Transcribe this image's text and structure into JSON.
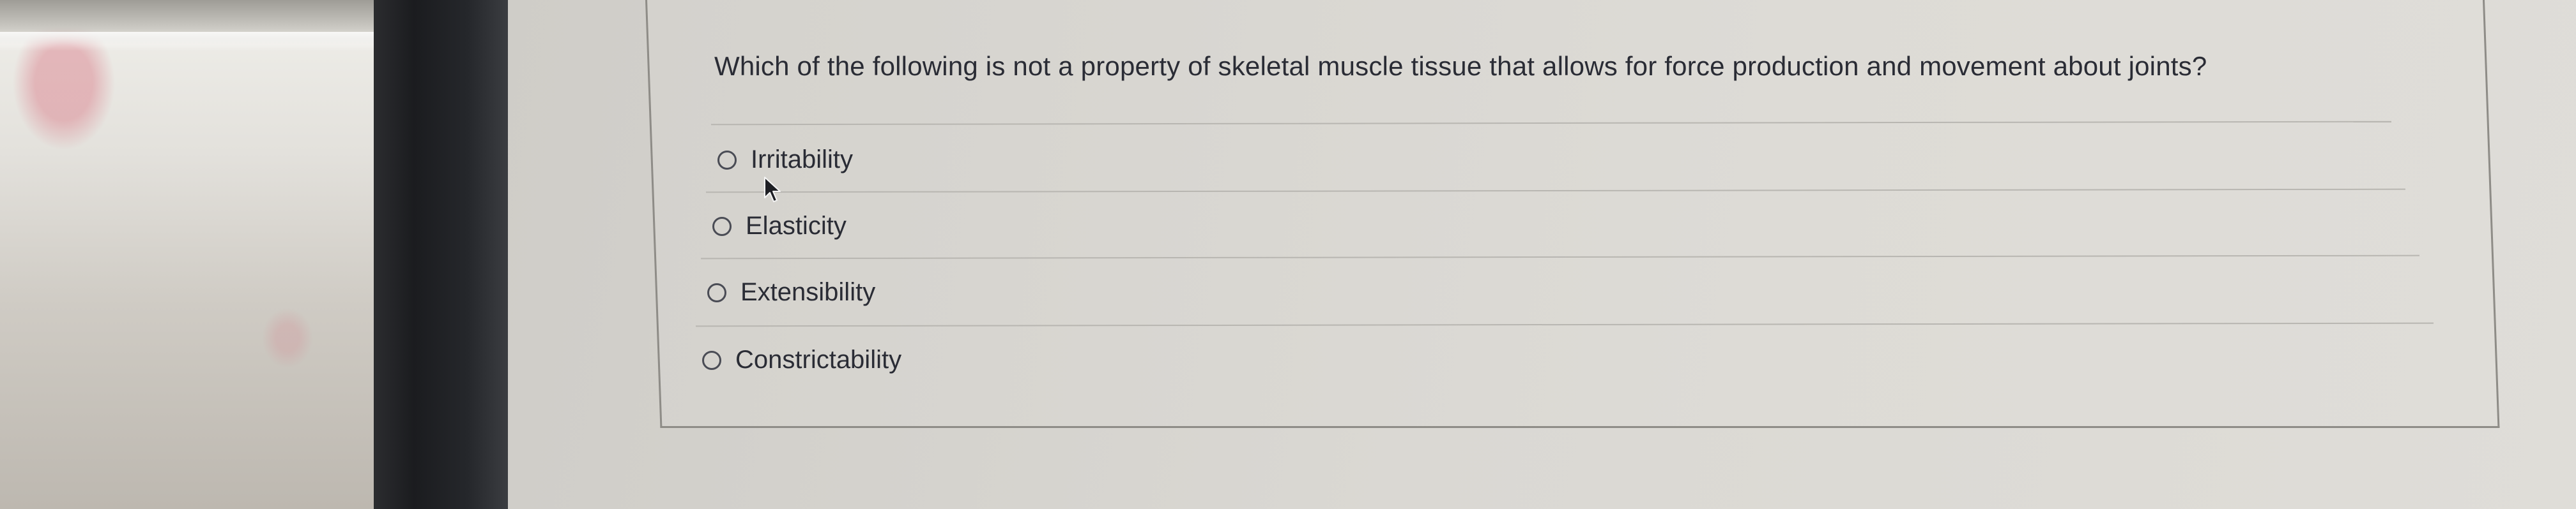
{
  "question": {
    "text": "Which of the following is not a property of skeletal muscle tissue that allows for force production and movement about joints?",
    "options": [
      {
        "label": "Irritability",
        "selected": false
      },
      {
        "label": "Elasticity",
        "selected": false
      },
      {
        "label": "Extensibility",
        "selected": false
      },
      {
        "label": "Constrictability",
        "selected": false
      }
    ]
  },
  "colors": {
    "text": "#2a2c35",
    "card_border": "#8e8c87",
    "divider": "#b8b6b1",
    "bezel": "#1b1c1f"
  },
  "icons": {
    "radio": "radio-unchecked-icon",
    "cursor": "mouse-pointer-icon"
  }
}
